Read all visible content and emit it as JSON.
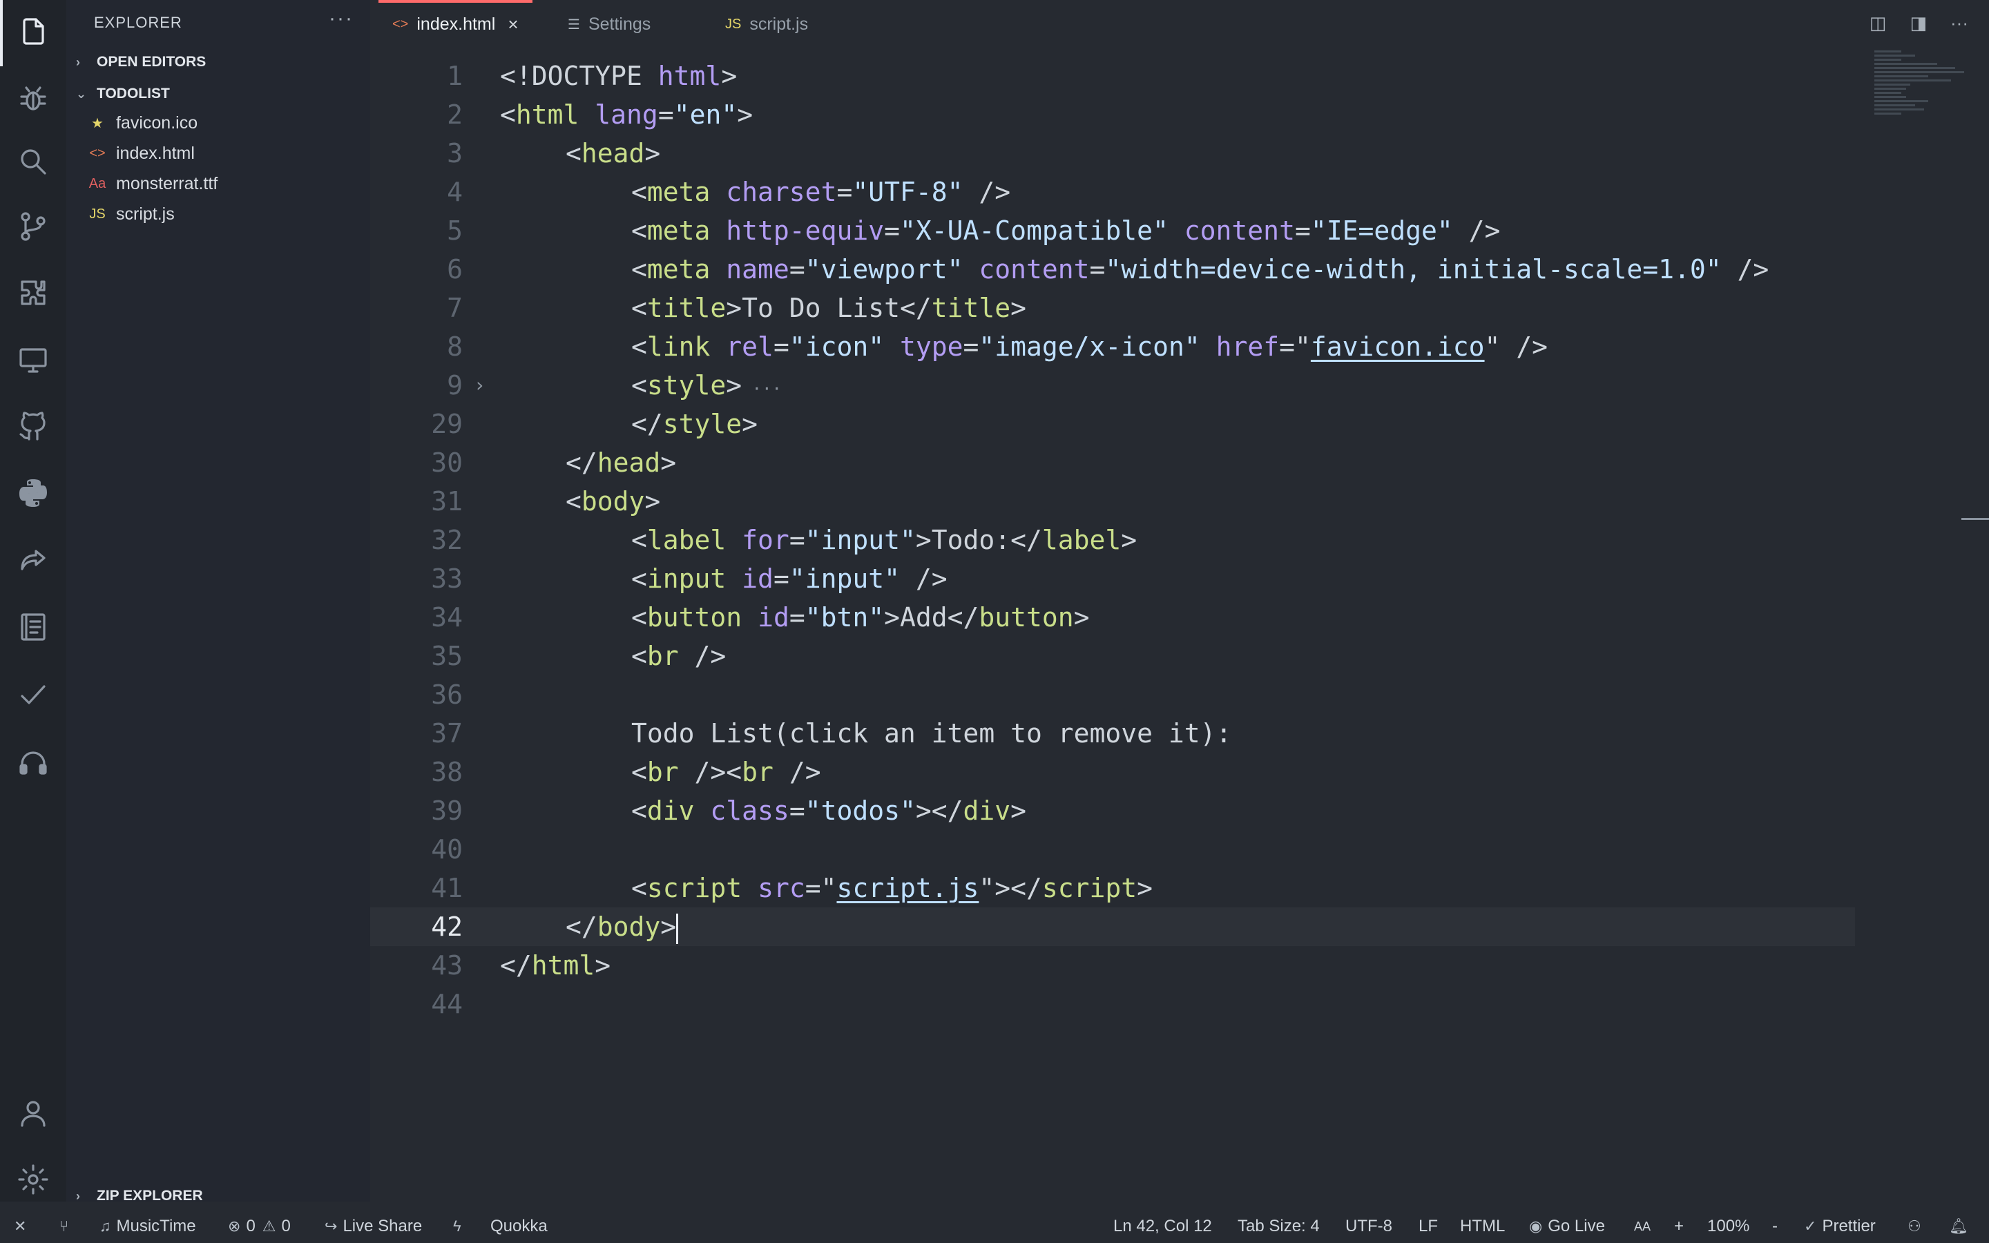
{
  "sidebar": {
    "title": "EXPLORER",
    "more": "···",
    "open_editors": "OPEN EDITORS",
    "project": "TODOLIST",
    "files": [
      {
        "name": "favicon.ico",
        "icon": "★",
        "icon_color": "#e6d76a"
      },
      {
        "name": "index.html",
        "icon": "<>",
        "icon_color": "#e07a55"
      },
      {
        "name": "monsterrat.ttf",
        "icon": "Aa",
        "icon_color": "#e06060"
      },
      {
        "name": "script.js",
        "icon": "JS",
        "icon_color": "#e6d76a"
      }
    ],
    "zip_explorer": "ZIP EXPLORER"
  },
  "tabs": [
    {
      "label": "index.html",
      "icon": "<>",
      "active": true
    },
    {
      "label": "Settings",
      "icon": "☰",
      "active": false
    },
    {
      "label": "script.js",
      "icon": "JS",
      "active": false
    }
  ],
  "tab_close": "×",
  "editor": {
    "lines": [
      {
        "n": "1"
      },
      {
        "n": "2"
      },
      {
        "n": "3"
      },
      {
        "n": "4"
      },
      {
        "n": "5"
      },
      {
        "n": "6"
      },
      {
        "n": "7"
      },
      {
        "n": "8"
      },
      {
        "n": "9"
      },
      {
        "n": "29"
      },
      {
        "n": "30"
      },
      {
        "n": "31"
      },
      {
        "n": "32"
      },
      {
        "n": "33"
      },
      {
        "n": "34"
      },
      {
        "n": "35"
      },
      {
        "n": "36"
      },
      {
        "n": "37"
      },
      {
        "n": "38"
      },
      {
        "n": "39"
      },
      {
        "n": "40"
      },
      {
        "n": "41"
      },
      {
        "n": "42"
      },
      {
        "n": "43"
      },
      {
        "n": "44"
      }
    ],
    "text": {
      "doctype": "<!DOCTYPE",
      "html": "html",
      "lang": "lang",
      "lang_val": "\"en\"",
      "head": "head",
      "meta": "meta",
      "charset": "charset",
      "charset_val": "\"UTF-8\"",
      "http_equiv": "http-equiv",
      "http_equiv_val": "\"X-UA-Compatible\"",
      "content": "content",
      "content_val": "\"IE=edge\"",
      "name": "name",
      "name_val": "\"viewport\"",
      "viewport_val": "\"width=device-width, initial-scale=1.0\"",
      "title": "title",
      "title_text": "To Do List",
      "link": "link",
      "rel": "rel",
      "rel_val": "\"icon\"",
      "type": "type",
      "type_val": "\"image/x-icon\"",
      "href": "href",
      "href_val": "favicon.ico",
      "style": "style",
      "body": "body",
      "label": "label",
      "for": "for",
      "for_val": "\"input\"",
      "label_text": "Todo:",
      "input": "input",
      "id": "id",
      "id_val": "\"input\"",
      "button": "button",
      "btn_val": "\"btn\"",
      "button_text": "Add",
      "br": "br",
      "todo_list_text": "Todo List(click an item to remove it):",
      "div": "div",
      "class": "class",
      "class_val": "\"todos\"",
      "script": "script",
      "src": "src",
      "src_val": "script.js"
    }
  },
  "status": {
    "music": "MusicTime",
    "errors": "0",
    "warnings": "0",
    "live_share": "Live Share",
    "quokka": "Quokka",
    "position": "Ln 42, Col 12",
    "tab_size": "Tab Size: 4",
    "encoding": "UTF-8",
    "eol": "LF",
    "language": "HTML",
    "go_live": "Go Live",
    "font_size": "AA",
    "plus": "+",
    "zoom": "100%",
    "minus": "-",
    "prettier": "Prettier"
  }
}
